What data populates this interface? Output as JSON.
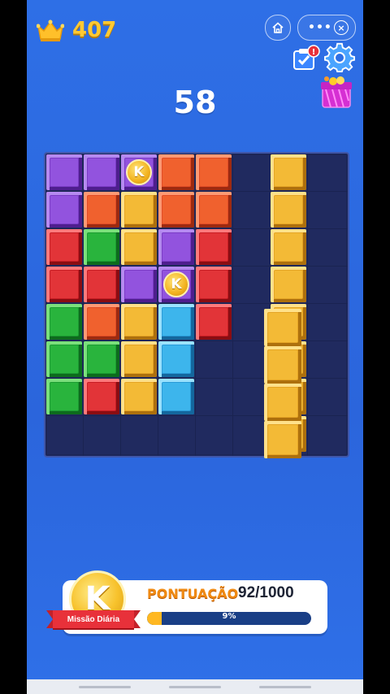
{
  "top": {
    "best_score": "407",
    "icons": [
      "crown-icon",
      "home-icon",
      "more-icon",
      "close-icon",
      "tasks-icon",
      "settings-icon",
      "gift-icon"
    ],
    "tasks_badge": "!"
  },
  "game": {
    "score": "58",
    "board_size": 8,
    "cells": [
      [
        "purple",
        "purple",
        "purple-coin",
        "orange",
        "orange",
        "",
        "yellow",
        ""
      ],
      [
        "purple",
        "orange",
        "yellow",
        "orange",
        "orange",
        "",
        "yellow",
        ""
      ],
      [
        "red",
        "green",
        "yellow",
        "purple",
        "red",
        "",
        "yellow",
        ""
      ],
      [
        "red",
        "red",
        "purple",
        "purple-coin",
        "red",
        "",
        "yellow",
        ""
      ],
      [
        "green",
        "orange",
        "yellow",
        "blue",
        "red",
        "",
        "yellow",
        ""
      ],
      [
        "green",
        "green",
        "yellow",
        "blue",
        "",
        "",
        "yellow",
        ""
      ],
      [
        "green",
        "red",
        "yellow",
        "blue",
        "",
        "",
        "yellow",
        ""
      ],
      [
        "",
        "",
        "",
        "",
        "",
        "",
        "yellow",
        ""
      ]
    ],
    "coin_letter": "K",
    "dragged_piece": {
      "color": "yellow",
      "length": 4
    }
  },
  "mission": {
    "coin_letter": "K",
    "ribbon_label": "Missão Diária",
    "points_label": "PONTUAÇÃO",
    "points_value": "92/1000",
    "progress_fraction": 0.09,
    "progress_text": "9%"
  },
  "colors": {
    "background": "#2e6fe6",
    "board": "#202a5f",
    "accent_gold": "#ffc933",
    "progress_fill": "#ffb822"
  }
}
